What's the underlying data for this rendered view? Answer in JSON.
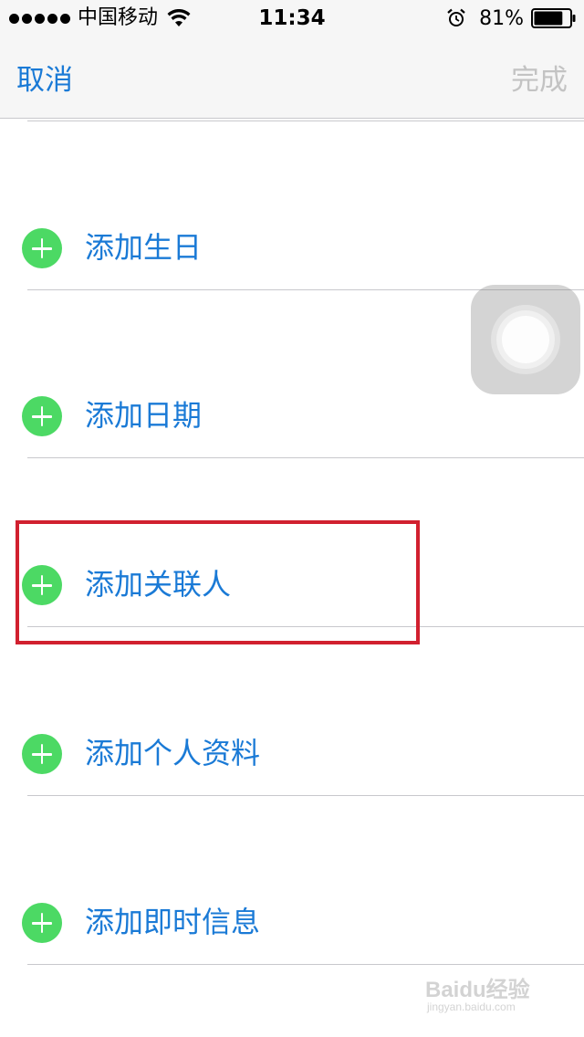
{
  "status_bar": {
    "carrier": "中国移动",
    "time": "11:34",
    "battery_percent": "81%",
    "battery_level": 0.81,
    "icons": [
      "signal-dots-icon",
      "wifi-icon",
      "alarm-icon",
      "battery-icon"
    ]
  },
  "nav": {
    "cancel_label": "取消",
    "done_label": "完成"
  },
  "rows": [
    {
      "label": "添加生日",
      "icon": "add-circle-icon"
    },
    {
      "label": "添加日期",
      "icon": "add-circle-icon"
    },
    {
      "label": "添加关联人",
      "icon": "add-circle-icon",
      "highlighted": true
    },
    {
      "label": "添加个人资料",
      "icon": "add-circle-icon"
    },
    {
      "label": "添加即时信息",
      "icon": "add-circle-icon"
    }
  ],
  "assistive_touch": {
    "icon": "assistive-touch-icon"
  },
  "watermark": {
    "main": "Baidu经验",
    "sub": "jingyan.baidu.com"
  },
  "colors": {
    "accent_blue": "#1a7ad6",
    "add_green": "#4cd964",
    "highlight_red": "#d1202f",
    "done_disabled": "#c3c3c3"
  }
}
